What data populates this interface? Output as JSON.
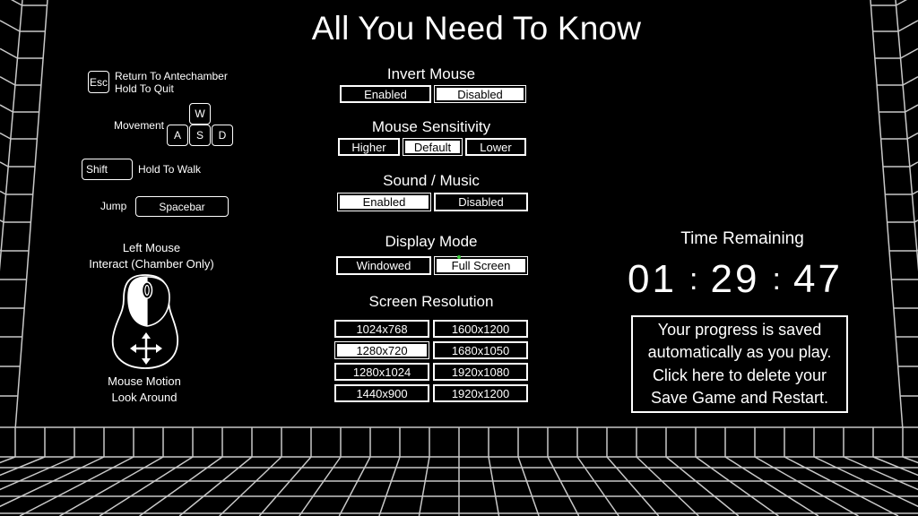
{
  "title": "All You Need To Know",
  "controls": {
    "esc": {
      "key": "Esc",
      "line1": "Return To Antechamber",
      "line2": "Hold To Quit"
    },
    "movement": {
      "label": "Movement",
      "keys": {
        "up": "W",
        "left": "A",
        "down": "S",
        "right": "D"
      }
    },
    "walk": {
      "key": "Shift",
      "label": "Hold To Walk"
    },
    "jump": {
      "label": "Jump",
      "key": "Spacebar"
    },
    "mouse": {
      "top_line1": "Left Mouse",
      "top_line2": "Interact (Chamber Only)",
      "bottom_line1": "Mouse Motion",
      "bottom_line2": "Look Around"
    }
  },
  "settings": {
    "invert_mouse": {
      "label": "Invert Mouse",
      "options": [
        "Enabled",
        "Disabled"
      ],
      "selected": "Disabled"
    },
    "mouse_sensitivity": {
      "label": "Mouse Sensitivity",
      "options": [
        "Higher",
        "Default",
        "Lower"
      ],
      "selected": "Default"
    },
    "sound_music": {
      "label": "Sound / Music",
      "options": [
        "Enabled",
        "Disabled"
      ],
      "selected": "Enabled"
    },
    "display_mode": {
      "label": "Display Mode",
      "options": [
        "Windowed",
        "Full Screen"
      ],
      "selected": "Full Screen"
    },
    "screen_resolution": {
      "label": "Screen Resolution",
      "options": [
        "1024x768",
        "1600x1200",
        "1280x720",
        "1680x1050",
        "1280x1024",
        "1920x1080",
        "1440x900",
        "1920x1200"
      ],
      "selected": "1280x720"
    }
  },
  "timer": {
    "label": "Time Remaining",
    "hours": "01",
    "minutes": "29",
    "seconds": "47",
    "separator": ":"
  },
  "save_notice": {
    "lines": [
      "Your progress is saved",
      "automatically as you play.",
      "Click here to delete your",
      "Save Game and Restart."
    ]
  },
  "colors": {
    "background": "#000000",
    "foreground": "#ffffff",
    "grid": "#c8c8c8",
    "cursor": "#3fcf3f"
  }
}
